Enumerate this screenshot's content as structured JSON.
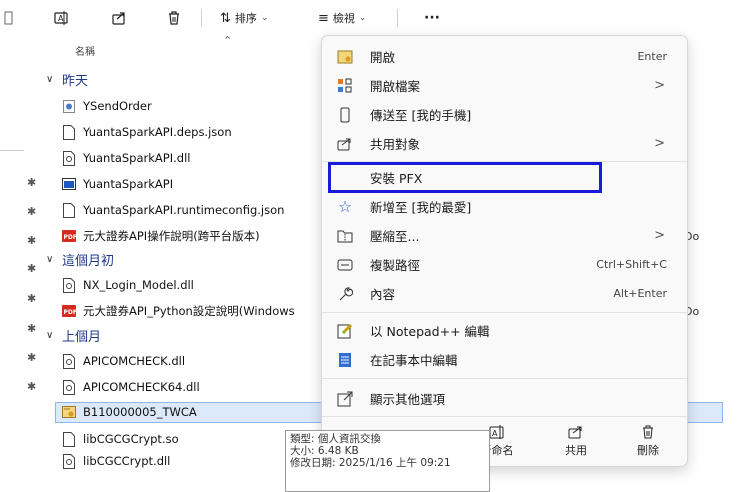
{
  "toolbar": {
    "sort_label": "排序",
    "view_label": "檢視",
    "more_label": "···"
  },
  "column_header": "名稱",
  "groups": [
    {
      "label": "昨天"
    },
    {
      "label": "這個月初"
    },
    {
      "label": "上個月"
    }
  ],
  "files": [
    {
      "name": "YSendOrder",
      "icon": "application-icon"
    },
    {
      "name": "YuantaSparkAPI.deps.json",
      "icon": "file-icon"
    },
    {
      "name": "YuantaSparkAPI.dll",
      "icon": "dll-file-icon"
    },
    {
      "name": "YuantaSparkAPI",
      "icon": "app-window-icon"
    },
    {
      "name": "YuantaSparkAPI.runtimeconfig.json",
      "icon": "file-icon"
    },
    {
      "name": "元大證券API操作說明(跨平台版本)",
      "icon": "pdf-icon"
    },
    {
      "name": "NX_Login_Model.dll",
      "icon": "dll-file-icon"
    },
    {
      "name": "元大證券API_Python設定說明(Windows",
      "icon": "pdf-icon"
    },
    {
      "name": "APICOMCHECK.dll",
      "icon": "dll-file-icon"
    },
    {
      "name": "APICOMCHECK64.dll",
      "icon": "dll-file-icon"
    },
    {
      "name": "B110000005_TWCA",
      "icon": "certificate-icon"
    },
    {
      "name": "libCGCGCrypt.so",
      "icon": "file-icon"
    },
    {
      "name": "libCGCCrypt.dll",
      "icon": "dll-file-icon"
    }
  ],
  "right_clipped_text": [
    "Do",
    "Do"
  ],
  "context_menu": {
    "items": [
      {
        "label": "開啟",
        "shortcut": "Enter",
        "icon": "open-icon"
      },
      {
        "label": "開啟檔案",
        "has_submenu": true,
        "icon": "open-with-icon"
      },
      {
        "label": "傳送至 [我的手機]",
        "icon": "phone-icon"
      },
      {
        "label": "共用對象",
        "has_submenu": true,
        "icon": "share-icon"
      },
      {
        "label": "安裝 PFX",
        "icon": "none",
        "highlighted": true
      },
      {
        "label": "新增至 [我的最愛]",
        "icon": "star-icon"
      },
      {
        "label": "壓縮至...",
        "has_submenu": true,
        "icon": "zip-folder-icon"
      },
      {
        "label": "複製路徑",
        "shortcut": "Ctrl+Shift+C",
        "icon": "copy-path-icon"
      },
      {
        "label": "內容",
        "shortcut": "Alt+Enter",
        "icon": "wrench-icon"
      },
      {
        "label": "以 Notepad++ 編輯",
        "icon": "notepad-plus-icon"
      },
      {
        "label": "在記事本中編輯",
        "icon": "notepad-icon"
      },
      {
        "label": "顯示其他選項",
        "icon": "more-options-icon"
      }
    ],
    "bottom_actions": [
      {
        "label": "新命名",
        "icon": "rename-icon"
      },
      {
        "label": "共用",
        "icon": "share-icon"
      },
      {
        "label": "刪除",
        "icon": "trash-icon"
      }
    ],
    "arrow_glyph": ">"
  },
  "tooltip": {
    "line1": "類型: 個人資訊交換",
    "line2": "大小: 6.48 KB",
    "line3": "修改日期: 2025/1/16 上午 09:21"
  },
  "colors": {
    "accent_selection": "#dbe9fb",
    "group_header": "#1f3a8a",
    "highlight_box": "#1a1adb"
  }
}
